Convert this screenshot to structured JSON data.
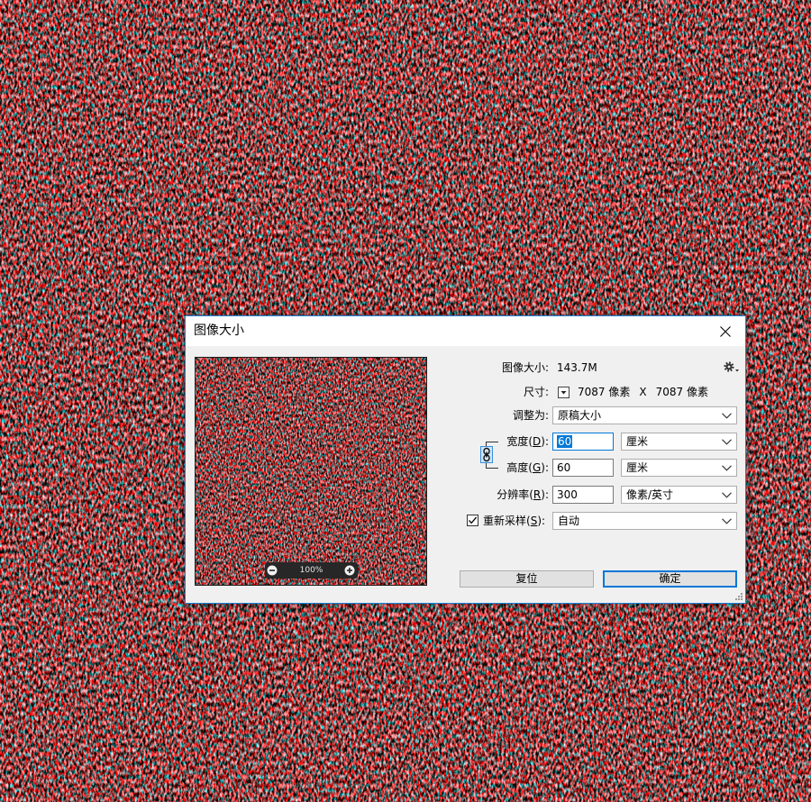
{
  "colors": {
    "accent": "#0078d7",
    "dialog_border": "#1883d7",
    "dialog_bg": "#f0f0f0",
    "titlebar_bg": "#ffffff",
    "button_bg": "#e1e1e1"
  },
  "dialog": {
    "title": "图像大小",
    "close_icon": "close-icon",
    "preview": {
      "zoom_out_icon": "zoom-out-icon",
      "zoom_level": "100%",
      "zoom_in_icon": "zoom-in-icon"
    },
    "image_size": {
      "label": "图像大小:",
      "value": "143.7M",
      "settings_icon": "gear-icon"
    },
    "dimensions": {
      "label": "尺寸:",
      "menu_icon": "dropdown-arrow-icon",
      "width": "7087 像素",
      "separator": "X",
      "height": "7087 像素"
    },
    "fit_to": {
      "label": "调整为:",
      "value": "原稿大小"
    },
    "constrain_proportions": {
      "icon": "link-icon",
      "enabled": true
    },
    "width": {
      "label": "宽度(D):",
      "value": "60",
      "selected": true,
      "unit": "厘米"
    },
    "height": {
      "label": "高度(G):",
      "value": "60",
      "unit": "厘米"
    },
    "resolution": {
      "label": "分辨率(R):",
      "value": "300",
      "unit": "像素/英寸"
    },
    "resample": {
      "checked": true,
      "label": "重新采样(S):",
      "value": "自动"
    },
    "buttons": {
      "reset": "复位",
      "ok": "确定"
    }
  }
}
